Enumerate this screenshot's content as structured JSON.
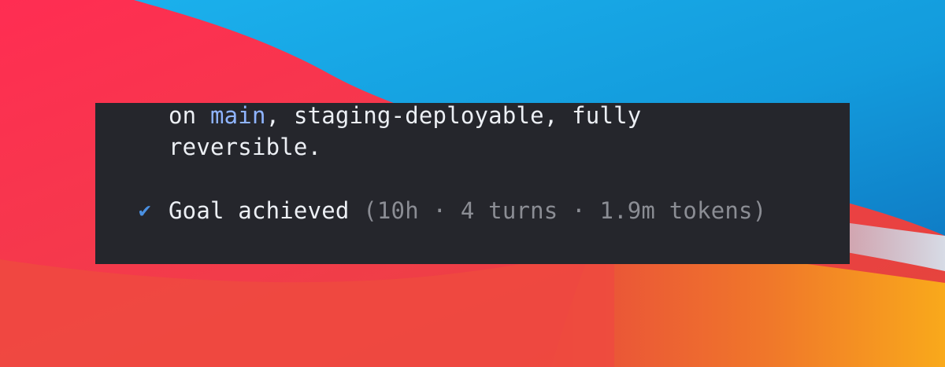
{
  "colors": {
    "terminal_background": "#25262c",
    "text": "#eceff4",
    "branch_highlight": "#8fb4ff",
    "muted_stats": "#8b8d94",
    "success_check": "#4a90e2"
  },
  "terminal": {
    "line1": {
      "prefix": "on ",
      "branch": "main",
      "suffix": ", staging-deployable, fully"
    },
    "line2": "reversible.",
    "status": {
      "icon": "check-icon",
      "check_glyph": "✔",
      "text": "Goal achieved",
      "stats": " (10h · 4 turns · 1.9m tokens)"
    }
  }
}
